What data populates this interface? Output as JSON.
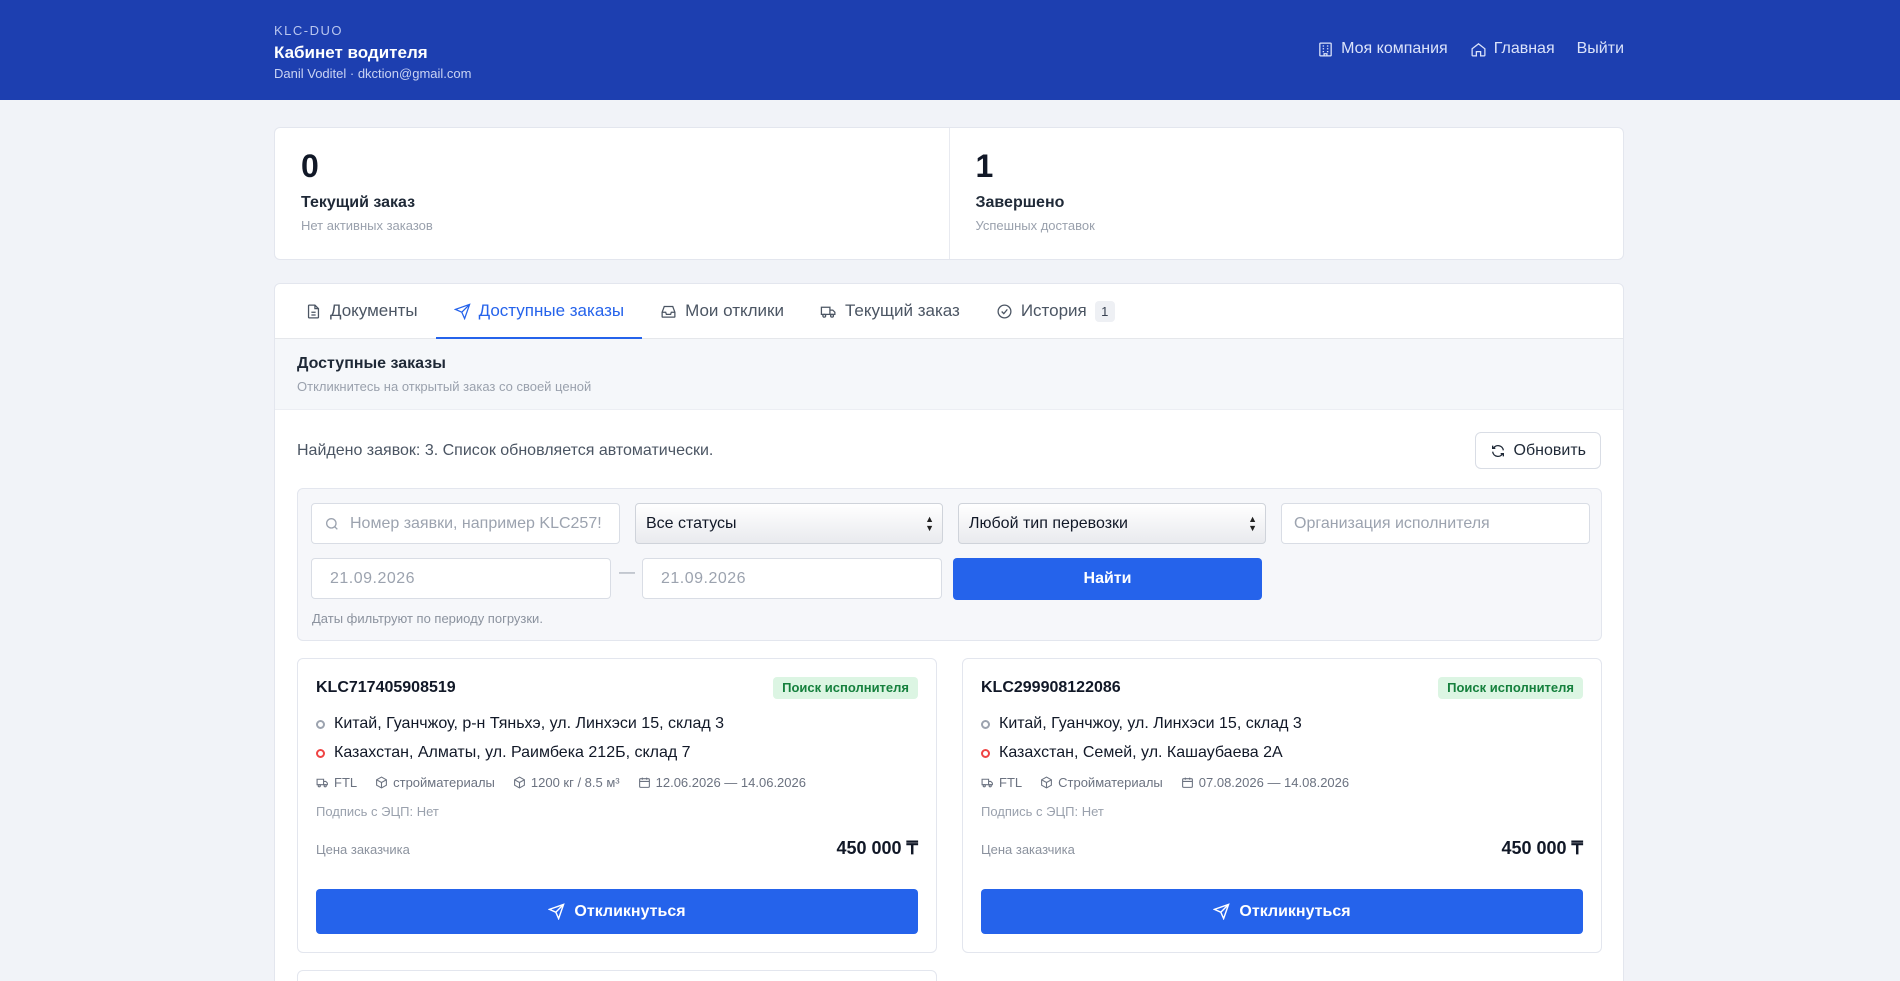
{
  "header": {
    "brand_small": "KLC-DUO",
    "title": "Кабинет водителя",
    "user": "Danil Voditel · dkction@gmail.com",
    "nav": [
      {
        "label": "Моя компания",
        "icon": "building-icon"
      },
      {
        "label": "Главная",
        "icon": "home-icon"
      },
      {
        "label": "Выйти",
        "icon": ""
      }
    ]
  },
  "stats": [
    {
      "value": "0",
      "label": "Текущий заказ",
      "sub": "Нет активных заказов"
    },
    {
      "value": "1",
      "label": "Завершено",
      "sub": "Успешных доставок"
    }
  ],
  "tabs": [
    {
      "label": "Документы",
      "icon": "document-icon",
      "active": false
    },
    {
      "label": "Доступные заказы",
      "icon": "send-icon",
      "active": true
    },
    {
      "label": "Мои отклики",
      "icon": "inbox-icon",
      "active": false
    },
    {
      "label": "Текущий заказ",
      "icon": "truck-icon",
      "active": false
    },
    {
      "label": "История",
      "icon": "check-circle-icon",
      "active": false,
      "count": "1"
    }
  ],
  "section": {
    "title": "Доступные заказы",
    "subtitle": "Откликнитесь на открытый заказ со своей ценой"
  },
  "found_text": "Найдено заявок: 3. Список обновляется автоматически.",
  "refresh_label": "Обновить",
  "filters": {
    "search_placeholder": "Номер заявки, например KLC257!",
    "status_value": "Все статусы",
    "transport_value": "Любой тип перевозки",
    "org_placeholder": "Организация исполнителя",
    "date_from": "21.09.2026",
    "date_to": "21.09.2026",
    "date_separator": "—",
    "find_label": "Найти",
    "hint": "Даты фильтруют по периоду погрузки."
  },
  "orders": [
    {
      "id": "KLC717405908519",
      "status": "Поиск исполнителя",
      "from": "Китай, Гуанчжоу, р-н Тяньхэ, ул. Линхэси 15, склад 3",
      "to": "Казахстан, Алматы, ул. Раимбека 212Б, склад 7",
      "type": "FTL",
      "cargo": "стройматериалы",
      "weight": "1200 кг / 8.5 м³",
      "dates": "12.06.2026 — 14.06.2026",
      "sign": "Подпись с ЭЦП: Нет",
      "price_label": "Цена заказчика",
      "price": "450 000 ₸",
      "action": "Откликнуться"
    },
    {
      "id": "KLC299908122086",
      "status": "Поиск исполнителя",
      "from": "Китай, Гуанчжоу, ул. Линхэси 15, склад 3",
      "to": "Казахстан, Семей, ул. Кашаубаева 2А",
      "type": "FTL",
      "cargo": "Стройматериалы",
      "dates": "07.08.2026 — 14.08.2026",
      "sign": "Подпись с ЭЦП: Нет",
      "price_label": "Цена заказчика",
      "price": "450 000 ₸",
      "action": "Откликнуться"
    }
  ],
  "colors": {
    "header_bg": "#1d3fb0",
    "accent": "#2563eb",
    "badge_bg": "#dcf5e3",
    "badge_text": "#15803d"
  }
}
